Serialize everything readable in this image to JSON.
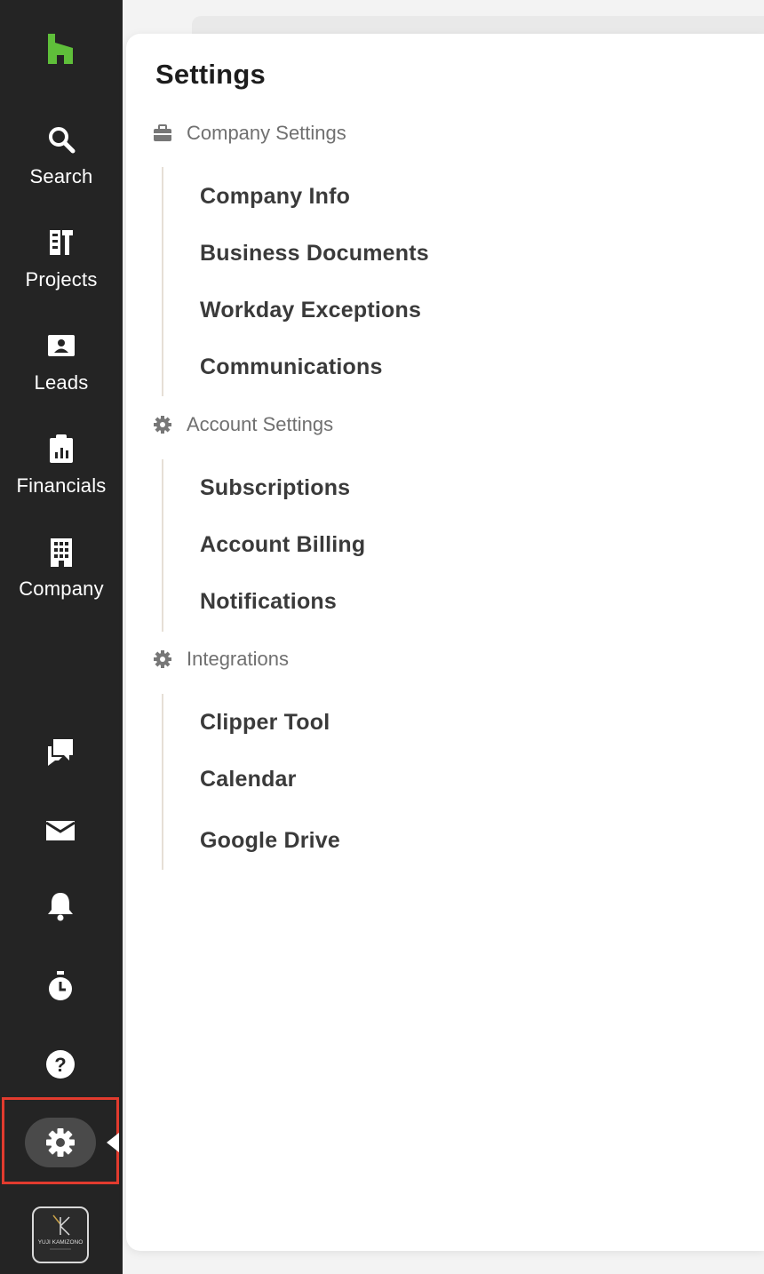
{
  "sidebar": {
    "nav": [
      {
        "label": "Search",
        "icon": "search-icon"
      },
      {
        "label": "Projects",
        "icon": "projects-icon"
      },
      {
        "label": "Leads",
        "icon": "leads-icon"
      },
      {
        "label": "Financials",
        "icon": "financials-icon"
      },
      {
        "label": "Company",
        "icon": "company-icon"
      }
    ],
    "tools": [
      "chat-icon",
      "mail-icon",
      "bell-icon",
      "timer-icon",
      "help-icon",
      "gear-icon"
    ],
    "avatar_text": "YUJI KAMIZONO",
    "brand_color": "#5fbf3a",
    "highlight_color": "#e23b2e"
  },
  "panel": {
    "title": "Settings",
    "sections": [
      {
        "label": "Company Settings",
        "icon": "briefcase-icon",
        "items": [
          "Company Info",
          "Business Documents",
          "Workday Exceptions",
          "Communications"
        ]
      },
      {
        "label": "Account Settings",
        "icon": "gear-icon",
        "items": [
          "Subscriptions",
          "Account Billing",
          "Notifications"
        ]
      },
      {
        "label": "Integrations",
        "icon": "gear-icon",
        "items": [
          "Clipper Tool",
          "Calendar",
          "Google Drive"
        ]
      }
    ]
  }
}
